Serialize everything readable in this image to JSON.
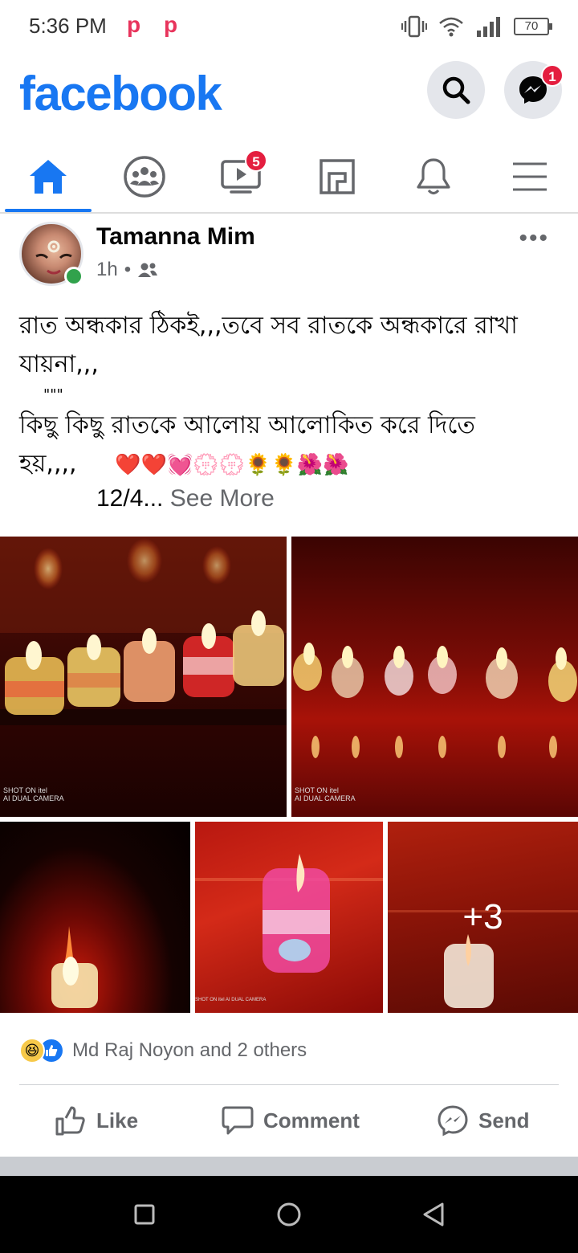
{
  "status_bar": {
    "time": "5:36 PM",
    "app_icons": [
      "p",
      "p"
    ],
    "battery": "70"
  },
  "header": {
    "logo": "facebook",
    "search_icon": "search-icon",
    "messenger_badge": "1"
  },
  "nav": {
    "tabs": [
      {
        "name": "home",
        "icon": "home-icon",
        "active": true
      },
      {
        "name": "groups",
        "icon": "groups-icon"
      },
      {
        "name": "watch",
        "icon": "watch-icon",
        "badge": "5"
      },
      {
        "name": "marketplace",
        "icon": "marketplace-icon"
      },
      {
        "name": "notifications",
        "icon": "bell-icon"
      },
      {
        "name": "menu",
        "icon": "menu-icon"
      }
    ]
  },
  "post": {
    "author": "Tamanna Mim",
    "time": "1h",
    "separator": "•",
    "audience_icon": "friends-icon",
    "text_line1": "রাত অন্ধকার ঠিকই,,,তবে সব রাতকে অন্ধকারে রাখা যায়না,,,",
    "quote_marks": "\"\"\"",
    "text_line2": "কিছু কিছু রাতকে আলোয় আলোকিত করে দিতে হয়,,,,",
    "emojis": "❤️❤️💓💮💮🌻🌻🌺🌺",
    "date_prefix": "12/4...",
    "see_more": "See More",
    "photo_captions": [
      "SHOT ON itel\nAI DUAL CAMERA",
      "SHOT ON itel\nAI DUAL CAMERA",
      "SHOT ON itel\nAI DUAL CAMERA"
    ],
    "more_photos": "+3"
  },
  "reactions": {
    "emojis": [
      "😆",
      "👍"
    ],
    "text": "Md Raj Noyon and 2 others"
  },
  "actions": {
    "like": "Like",
    "comment": "Comment",
    "send": "Send"
  },
  "colors": {
    "brand": "#1877f2",
    "badge": "#e41e3f",
    "online": "#31a24c",
    "secondary_text": "#65676b"
  }
}
